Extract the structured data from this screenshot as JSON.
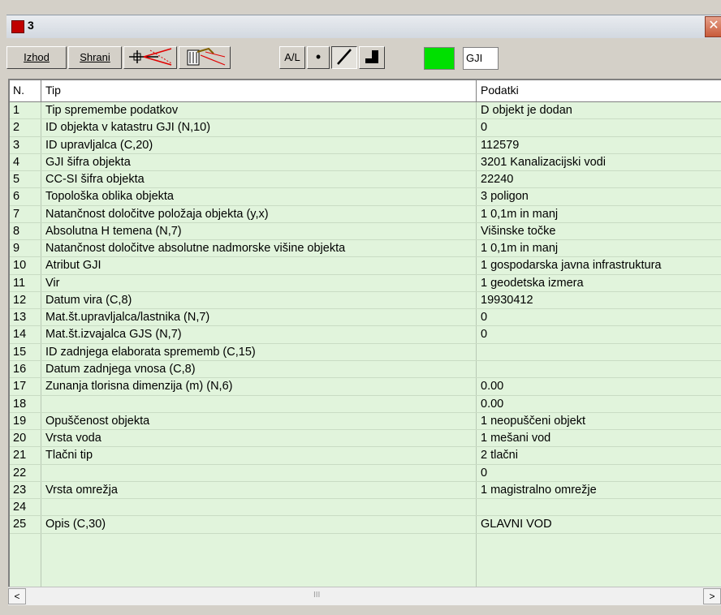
{
  "window": {
    "title": "3"
  },
  "toolbar": {
    "exit_label": "Izhod",
    "save_label": "Shrani",
    "al_label": "A/L",
    "code_value": "GJI",
    "color": "#00e000"
  },
  "grid": {
    "headers": {
      "n": "N.",
      "tip": "Tip",
      "podatki": "Podatki"
    },
    "rows": [
      {
        "n": "1",
        "tip": "Tip spremembe podatkov",
        "pod": "D objekt je dodan"
      },
      {
        "n": "2",
        "tip": "ID objekta v katastru GJI (N,10)",
        "pod": "0"
      },
      {
        "n": "3",
        "tip": "ID upravljalca (C,20)",
        "pod": "112579"
      },
      {
        "n": "4",
        "tip": "GJI šifra objekta",
        "pod": "3201 Kanalizacijski vodi"
      },
      {
        "n": "5",
        "tip": "CC-SI šifra objekta",
        "pod": "22240"
      },
      {
        "n": "6",
        "tip": "Topološka oblika objekta",
        "pod": "3 poligon"
      },
      {
        "n": "7",
        "tip": "Natančnost določitve položaja objekta (y,x)",
        "pod": "1 0,1m in manj"
      },
      {
        "n": "8",
        "tip": "Absolutna H temena (N,7)",
        "pod": "Višinske točke"
      },
      {
        "n": "9",
        "tip": "Natančnost določitve absolutne nadmorske višine objekta",
        "pod": "1 0,1m in manj"
      },
      {
        "n": "10",
        "tip": "Atribut GJI",
        "pod": "1 gospodarska javna infrastruktura"
      },
      {
        "n": "11",
        "tip": "Vir",
        "pod": "1 geodetska izmera"
      },
      {
        "n": "12",
        "tip": "Datum vira (C,8)",
        "pod": "19930412"
      },
      {
        "n": "13",
        "tip": "Mat.št.upravljalca/lastnika (N,7)",
        "pod": "0"
      },
      {
        "n": "14",
        "tip": "Mat.št.izvajalca GJS (N,7)",
        "pod": "0"
      },
      {
        "n": "15",
        "tip": "ID zadnjega elaborata sprememb (C,15)",
        "pod": ""
      },
      {
        "n": "16",
        "tip": "Datum zadnjega vnosa (C,8)",
        "pod": ""
      },
      {
        "n": "17",
        "tip": "Zunanja tlorisna dimenzija (m) (N,6)",
        "pod": "0.00"
      },
      {
        "n": "18",
        "tip": "",
        "pod": "0.00"
      },
      {
        "n": "19",
        "tip": "Opuščenost objekta",
        "pod": "1 neopuščeni objekt"
      },
      {
        "n": "20",
        "tip": "Vrsta voda",
        "pod": "1 mešani vod"
      },
      {
        "n": "21",
        "tip": "Tlačni tip",
        "pod": "2 tlačni"
      },
      {
        "n": "22",
        "tip": "",
        "pod": "0"
      },
      {
        "n": "23",
        "tip": "Vrsta omrežja",
        "pod": "1 magistralno omrežje"
      },
      {
        "n": "24",
        "tip": "",
        "pod": ""
      },
      {
        "n": "25",
        "tip": "Opis (C,30)",
        "pod": "GLAVNI VOD"
      }
    ]
  },
  "scrollbar": {
    "left_arrow": "<",
    "right_arrow": ">",
    "grip": "III"
  }
}
